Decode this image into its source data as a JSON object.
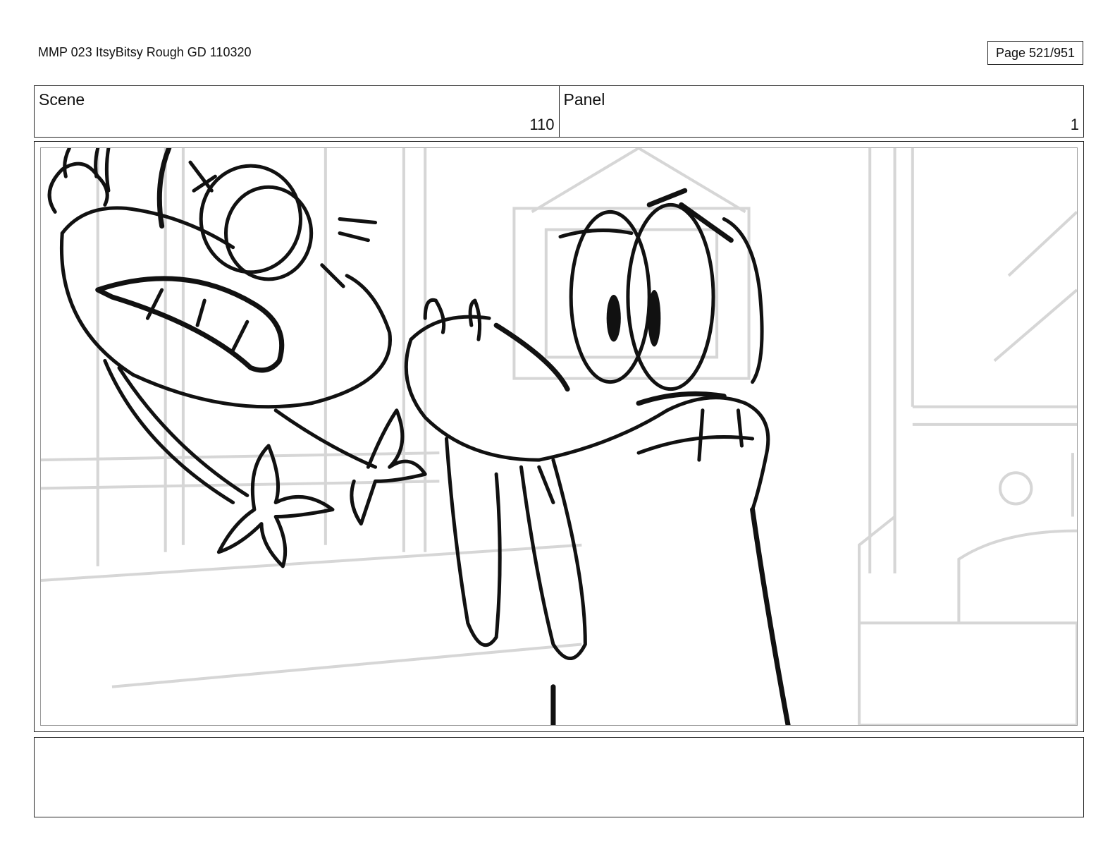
{
  "header": {
    "title": "MMP 023 ItsyBitsy Rough GD 110320",
    "page": "Page 521/951"
  },
  "info": {
    "scene_label": "Scene",
    "scene_value": "110",
    "panel_label": "Panel",
    "panel_value": "1"
  },
  "notes": {
    "text": ""
  }
}
